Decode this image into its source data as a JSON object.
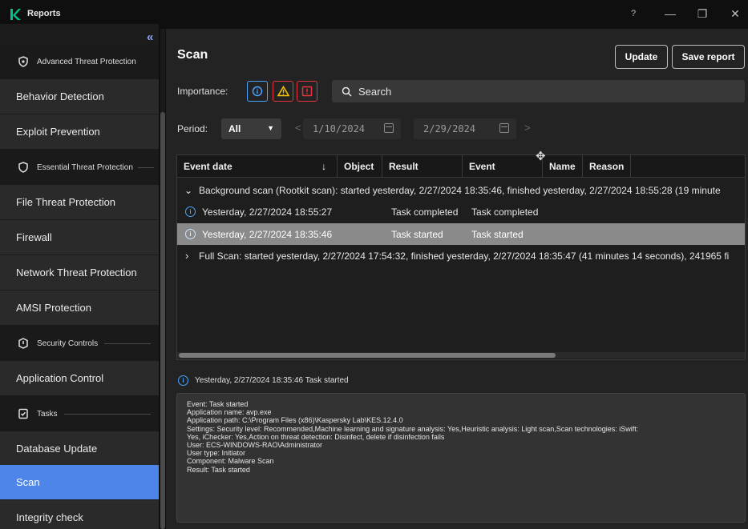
{
  "app": {
    "title": "Reports"
  },
  "window": {
    "help": "?",
    "minimize": "—",
    "restore": "❐",
    "close": "✕"
  },
  "sidebar": {
    "collapse": "«",
    "groups": {
      "atp": "Advanced Threat Protection",
      "etp": "Essential Threat Protection",
      "sc": "Security Controls",
      "tasks": "Tasks"
    },
    "items": {
      "behavior": "Behavior Detection",
      "exploit": "Exploit Prevention",
      "file": "File Threat Protection",
      "firewall": "Firewall",
      "network": "Network Threat Protection",
      "amsi": "AMSI Protection",
      "appcontrol": "Application Control",
      "dbupdate": "Database Update",
      "scan": "Scan",
      "integrity": "Integrity check"
    }
  },
  "header": {
    "title": "Scan",
    "update_label": "Update",
    "save_label": "Save report"
  },
  "filters": {
    "importance_label": "Importance:",
    "search_placeholder": "Search",
    "period_label": "Period:",
    "period_value": "All",
    "date_from": "1/10/2024",
    "date_to": "2/29/2024",
    "prev": "<",
    "next": ">"
  },
  "table": {
    "columns": {
      "event_date": "Event date",
      "sort_arrow": "↓",
      "object": "Object",
      "result": "Result",
      "event": "Event",
      "name": "Name",
      "reason": "Reason"
    },
    "group1": {
      "toggle": "⌄",
      "text": "Background scan (Rootkit scan): started yesterday, 2/27/2024 18:35:46, finished yesterday, 2/27/2024 18:55:28 (19 minute"
    },
    "row1": {
      "date": "Yesterday, 2/27/2024 18:55:27",
      "result": "Task completed",
      "event": "Task completed"
    },
    "row2": {
      "date": "Yesterday, 2/27/2024 18:35:46",
      "result": "Task started",
      "event": "Task started"
    },
    "group2": {
      "toggle": "›",
      "text": "Full Scan: started yesterday, 2/27/2024 17:54:32, finished yesterday, 2/27/2024 18:35:47 (41 minutes 14 seconds), 241965 fi"
    }
  },
  "details": {
    "heading": "Yesterday, 2/27/2024 18:35:46 Task started",
    "lines": {
      "l1": "Event: Task started",
      "l2": "Application name: avp.exe",
      "l3": "Application path: C:\\Program Files (x86)\\Kaspersky Lab\\KES.12.4.0",
      "l4": "Settings: Security level: Recommended,Machine learning and signature analysis: Yes,Heuristic analysis: Light scan,Scan technologies: iSwift:",
      "l5": "Yes, iChecker: Yes,Action on threat detection: Disinfect, delete if disinfection fails",
      "l6": "User: ECS-WINDOWS-RAO\\Administrator",
      "l7": "User type: Initiator",
      "l8": "Component: Malware Scan",
      "l9": "Result: Task started"
    }
  },
  "colors": {
    "accent": "#4d86e8",
    "info": "#4aa3ff",
    "warning": "#f5c400",
    "critical": "#e8323c"
  }
}
